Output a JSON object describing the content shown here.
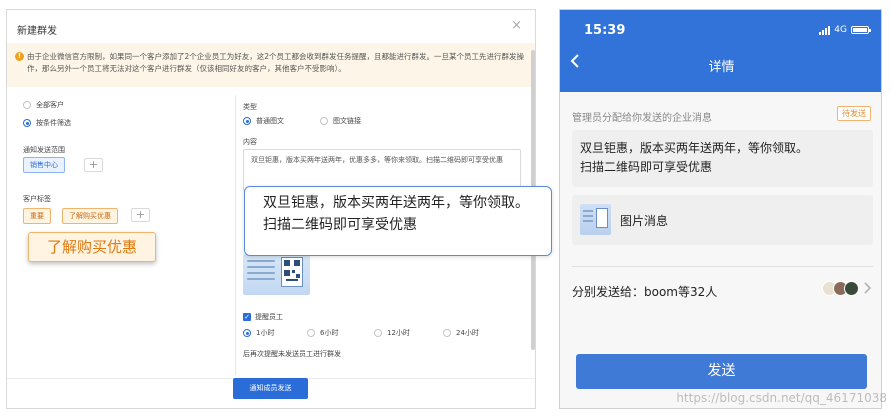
{
  "dialog": {
    "title": "新建群发",
    "close": "×",
    "notice": "由于企业微信官方限制，如果同一个客户添加了2个企业员工为好友，这2个员工都会收到群发任务提醒，且都能进行群发。一旦某个员工先进行群发操作，那么另外一个员工将无法对这个客户进行群发（仅该相同好友的客户，其他客户不受影响）。",
    "notice_icon": "!",
    "audience": {
      "all": "全部客户",
      "filter": "按条件筛选"
    },
    "scope": {
      "label": "通知发送范围",
      "tag": "销售中心",
      "add": "+"
    },
    "customer_tags": {
      "label": "客户标签",
      "tags": [
        "重要",
        "了解购买优惠"
      ],
      "add": "+"
    },
    "callout_tag": "了解购买优惠",
    "type": {
      "label": "类型",
      "options": [
        "普通图文",
        "图文链接"
      ]
    },
    "content": {
      "label": "内容",
      "text": "双旦钜惠，版本买两年送两年，优惠多多，等你来领取。扫描二维码即可享受优惠"
    },
    "bubble": {
      "line1": "双旦钜惠，版本买两年送两年，等你领取。",
      "line2": "扫描二维码即可享受优惠"
    },
    "remind": {
      "label": "提醒员工",
      "options": [
        "1小时",
        "6小时",
        "12小时",
        "24小时"
      ],
      "hint": "后再次提醒未发送员工进行群发"
    },
    "submit": "通知成员发送"
  },
  "phone": {
    "time": "15:39",
    "network": "4G",
    "title": "详情",
    "subhead": "管理员分配给你发送的企业消息",
    "status": "待发送",
    "message_line1": "双旦钜惠，版本买两年送两年，等你领取。",
    "message_line2": "扫描二维码即可享受优惠",
    "image_label": "图片消息",
    "send_to": "分别发送给：boom等32人",
    "send_button": "发送"
  },
  "watermark": "https://blog.csdn.net/qq_46171038",
  "colors": {
    "primary": "#2a6cd8",
    "phone_header": "#3273d9",
    "orange": "#e07a10",
    "notice_bg": "#fdf6e8"
  }
}
